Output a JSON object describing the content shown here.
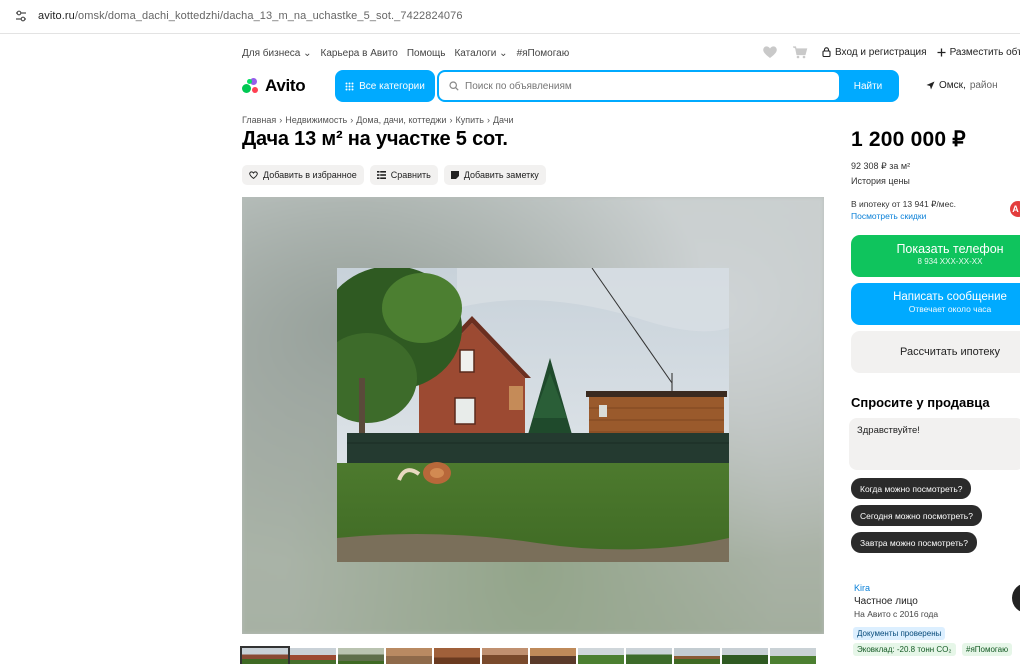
{
  "browser": {
    "url_domain": "avito.ru",
    "url_path": "/omsk/doma_dachi_kottedzhi/dacha_13_m_na_uchastke_5_sot._7422824076"
  },
  "topbar": {
    "links": [
      "Для бизнеса ⌄",
      "Карьера в Авито",
      "Помощь",
      "Каталоги ⌄",
      "#яПомогаю"
    ],
    "login": "Вход и регистрация",
    "post_ad": "Разместить объявление"
  },
  "header": {
    "logo": "Avito",
    "all_categories": "Все категории",
    "search_placeholder": "Поиск по объявлениям",
    "search_button": "Найти",
    "city": "Омск,",
    "city_rest": "район"
  },
  "breadcrumbs": [
    "Главная",
    "›",
    "Недвижимость",
    "›",
    "Дома, дачи, коттеджи",
    "›",
    "Купить",
    "›",
    "Дачи"
  ],
  "listing": {
    "title": "Дача 13 м² на участке 5 сот.",
    "actions": {
      "favorite": "Добавить в избранное",
      "compare": "Сравнить",
      "note": "Добавить заметку"
    }
  },
  "sidebar": {
    "price": "1 200 000 ₽",
    "price_per_sqm": "92 308 ₽ за м²",
    "price_history": "История цены",
    "mortgage": "В ипотеку от 13 941 ₽/мес.",
    "discounts": "Посмотреть скидки",
    "phone_button": "Показать телефон",
    "phone_masked": "8 934 XXX-XX-XX",
    "message_button": "Написать сообщение",
    "message_sub": "Отвечает около часа",
    "calc_button": "Рассчитать ипотеку",
    "ask_title": "Спросите у продавца",
    "ask_text": "Здравствуйте!",
    "chips": [
      "Когда можно посмотреть?",
      "Сегодня можно посмотреть?",
      "Завтра можно посмотреть?"
    ],
    "seller_name": "Kira",
    "seller_type": "Частное лицо",
    "seller_since": "На Авито с 2016 года",
    "tags": [
      "Документы проверены",
      "Эковклад: -20.8 тонн CO₂",
      "#яПомогаю"
    ]
  },
  "colors": {
    "accent_blue": "#00aaff",
    "phone_green": "#0fc45d",
    "link_blue": "#0a80d8"
  }
}
